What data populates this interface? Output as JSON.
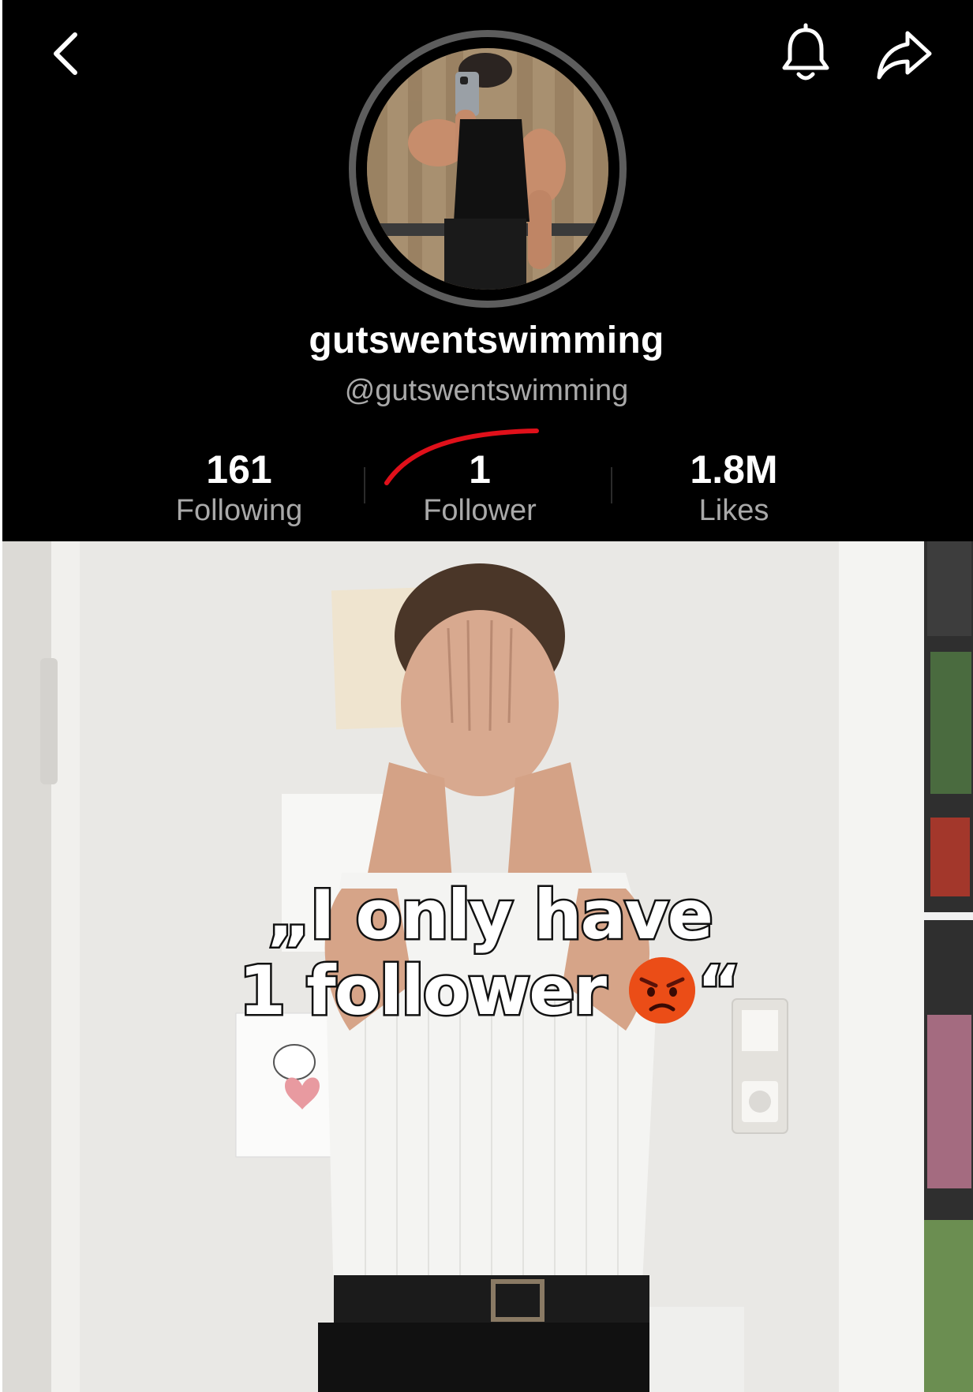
{
  "profile": {
    "display_name": "gutswentswimming",
    "handle": "@gutswentswimming",
    "stats": {
      "following_value": "161",
      "following_label": "Following",
      "follower_value": "1",
      "follower_label": "Follower",
      "likes_value": "1.8M",
      "likes_label": "Likes"
    }
  },
  "icons": {
    "back": "chevron-left-icon",
    "bell": "bell-icon",
    "share": "share-arrow-icon",
    "emoji": "angry-face-emoji"
  },
  "caption": {
    "line1": "„I only have",
    "line2": "1 follower",
    "close_quote": "“"
  },
  "colors": {
    "background_top": "#000000",
    "text_primary": "#ffffff",
    "text_secondary": "#a9a9a9",
    "avatar_ring": "#5d5d5d",
    "highlight_stroke": "#e0101a"
  }
}
